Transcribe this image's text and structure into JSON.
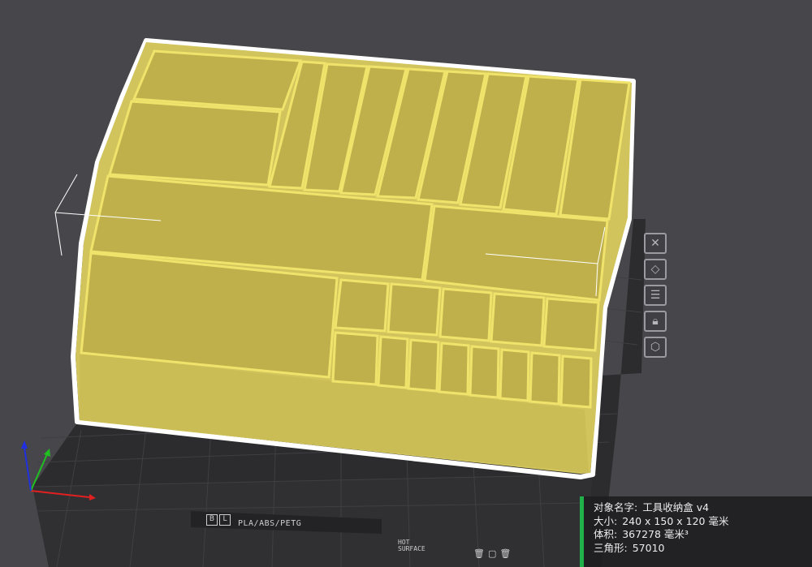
{
  "info": {
    "object_name_label": "对象名字:",
    "object_name": "工具收纳盒 v4",
    "size_label": "大小:",
    "size": "240 x 150 x 120 毫米",
    "volume_label": "体积:",
    "volume": "367278 毫米³",
    "triangles_label": "三角形:",
    "triangles": "57010"
  },
  "bed": {
    "material_label": "PLA/ABS/PETG",
    "hot_surface_line1": "HOT",
    "hot_surface_line2": "SURFACE"
  },
  "toolbar": {
    "icons": [
      "delete-icon",
      "rotate-icon",
      "arrange-icon",
      "lock-icon",
      "nut-settings-icon"
    ]
  },
  "colors": {
    "background": "#47474b",
    "model_fill": "#d2c45c",
    "model_edge": "#f2e46a",
    "selection_outline": "#ffffff",
    "bed": "#2c2c2e",
    "grid": "#3e3e42",
    "status_bar": "#21b14a",
    "axis_x": "#e02020",
    "axis_y": "#20c020",
    "axis_z": "#2030e0"
  }
}
